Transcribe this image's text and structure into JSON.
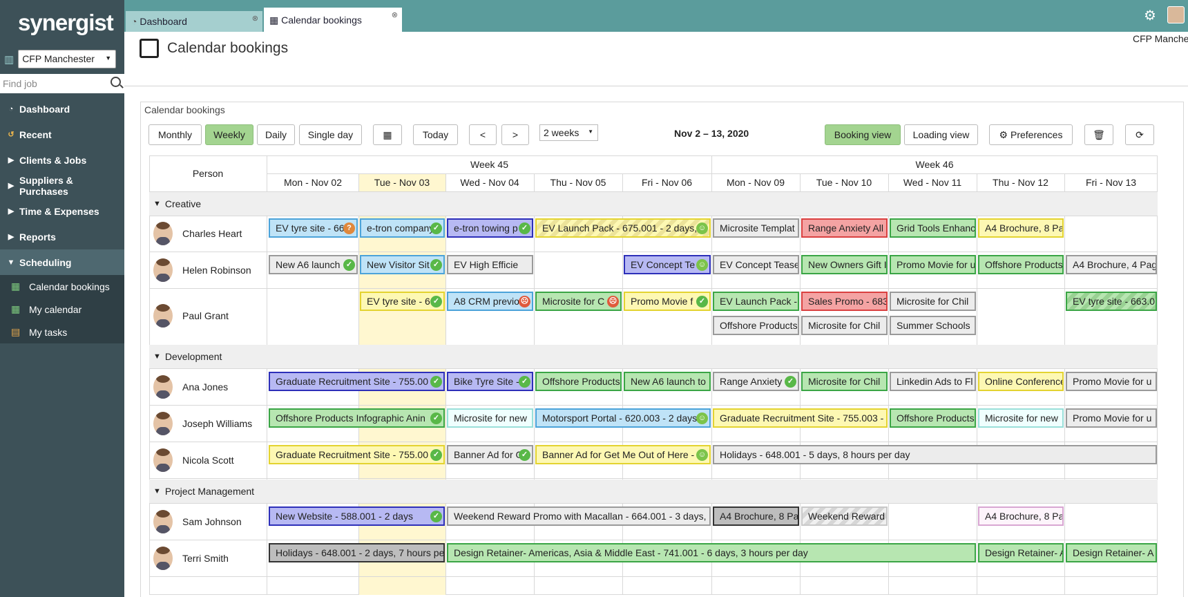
{
  "app": {
    "logo": "synergist",
    "office": "CFP Manchester",
    "find_placeholder": "Find job",
    "user_label": "CFP Manche"
  },
  "tabs": [
    {
      "label": "Dashboard"
    },
    {
      "label": "Calendar bookings"
    }
  ],
  "nav": {
    "items": [
      {
        "label": "Dashboard"
      },
      {
        "label": "Recent"
      },
      {
        "label": "Clients & Jobs"
      },
      {
        "label": "Suppliers & Purchases"
      },
      {
        "label": "Time & Expenses"
      },
      {
        "label": "Reports"
      },
      {
        "label": "Scheduling"
      }
    ],
    "sub": [
      {
        "label": "Calendar bookings"
      },
      {
        "label": "My calendar"
      },
      {
        "label": "My tasks"
      }
    ]
  },
  "page": {
    "title": "Calendar bookings",
    "panel_title": "Calendar bookings"
  },
  "toolbar": {
    "monthly": "Monthly",
    "weekly": "Weekly",
    "daily": "Daily",
    "single_day": "Single day",
    "today": "Today",
    "prev": "<",
    "next": ">",
    "range": "2 weeks",
    "date_range": "Nov 2 – 13, 2020",
    "booking_view": "Booking view",
    "loading_view": "Loading view",
    "preferences": "Preferences"
  },
  "grid": {
    "person_header": "Person",
    "weeks": [
      "Week 45",
      "Week 46"
    ],
    "days": [
      "Mon - Nov 02",
      "Tue - Nov 03",
      "Wed - Nov 04",
      "Thu - Nov 05",
      "Fri - Nov 06",
      "Mon - Nov 09",
      "Tue - Nov 10",
      "Wed - Nov 11",
      "Thu - Nov 12",
      "Fri - Nov 13"
    ],
    "groups": [
      "Creative",
      "Development",
      "Project Management"
    ],
    "people": [
      "Charles Heart",
      "Helen Robinson",
      "Paul Grant",
      "Ana Jones",
      "Joseph Williams",
      "Nicola Scott",
      "Sam Johnson",
      "Terri Smith"
    ]
  },
  "bookings": [
    "EV tyre site - 66",
    "e-tron company",
    "e-tron towing p",
    "EV Launch Pack - 675.001 - 2 days,",
    "Microsite Templat",
    "Range Anxiety All",
    "Grid Tools Enhanc",
    "A4 Brochure, 8 Pa",
    "New A6 launch",
    "New Visitor Sit",
    "EV High Efficie",
    "EV Concept Te",
    "EV Concept Tease",
    "New Owners Gift I",
    "Promo Movie for u",
    "Offshore Products",
    "A4 Brochure, 4 Pag",
    "EV tyre site - 66",
    "A8 CRM previo",
    "Microsite for C",
    "Promo Movie f",
    "EV Launch Pack -",
    "Sales Promo - 683",
    "Microsite for Chil",
    "EV tyre site - 663.0",
    "Offshore Products",
    "Microsite for Chil",
    "Summer Schools",
    "Graduate Recruitment Site - 755.00",
    "Bike Tyre Site -",
    "Offshore Products",
    "New A6 launch to",
    "Range Anxiety",
    "Microsite for Chil",
    "Linkedin Ads to Fl",
    "Online Conference",
    "Promo Movie for u",
    "Offshore Products Infographic Anin",
    "Microsite for new",
    "Motorsport Portal - 620.003 - 2 days",
    "Graduate Recruitment Site - 755.003 -",
    "Offshore Products",
    "Microsite for new",
    "Promo Movie for u",
    "Graduate Recruitment Site - 755.00",
    "Banner Ad for G",
    "Banner Ad for Get Me Out of Here - 6",
    "Holidays - 648.001 - 5 days, 8 hours per day",
    "New Website - 588.001 - 2 days",
    "Weekend Reward Promo with Macallan - 664.001 - 3 days, 7",
    "A4 Brochure, 8 Pa",
    "Weekend Reward",
    "A4 Brochure, 8 Pa",
    "Holidays - 648.001 - 2 days, 7 hours pe",
    "Design Retainer- Americas, Asia & Middle East - 741.001 - 6 days, 3 hours per day",
    "Design Retainer- A",
    "Design Retainer- A"
  ]
}
